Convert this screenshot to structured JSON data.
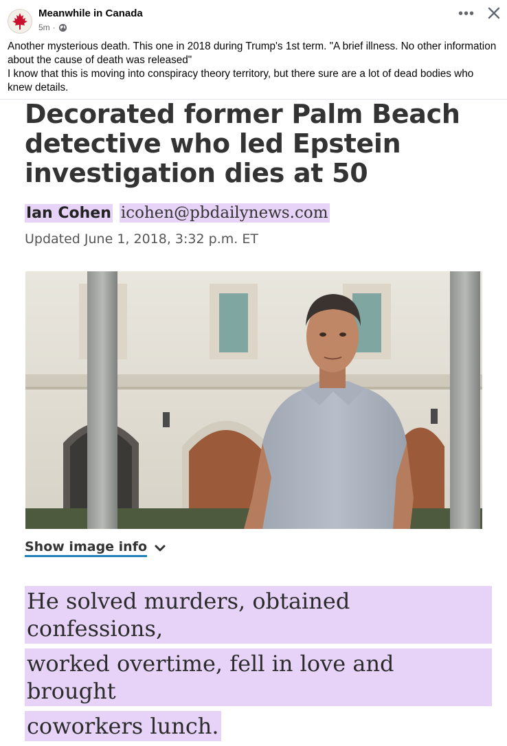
{
  "post": {
    "page_name": "Meanwhile in Canada",
    "time": "5m",
    "separator": "·",
    "more_icon": "more-options-icon",
    "close_icon": "close-icon",
    "caption_lines": [
      "Another mysterious death.  This one in 2018 during Trump's 1st term.  \"A brief illness. No other information about the cause of death was released\"",
      "I know that this is moving into conspiracy theory territory, but there sure are a lot of dead bodies who knew details."
    ]
  },
  "article": {
    "headline": "Decorated former Palm Beach detective who led Epstein investigation dies at 50",
    "author": "Ian Cohen",
    "email": "icohen@pbdailynews.com",
    "updated": "Updated June 1, 2018, 3:32 p.m. ET",
    "show_image_info": "Show image info",
    "lede_lines": [
      "He solved murders, obtained confessions,",
      "worked overtime, fell in love and brought",
      "coworkers lunch."
    ]
  },
  "colors": {
    "highlight": "#e7d3f7",
    "link_underline": "#1f7fb8",
    "meta_gray": "#65676b"
  }
}
